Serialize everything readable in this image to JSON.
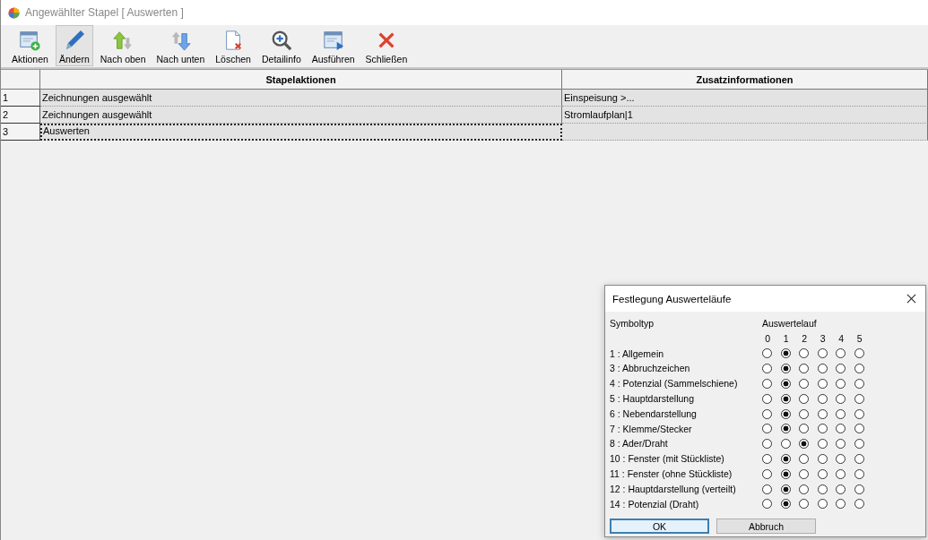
{
  "window": {
    "title": "Angewählter Stapel  [ Auswerten ]"
  },
  "toolbar": [
    {
      "kind": "add",
      "label": "Aktionen",
      "selected": false
    },
    {
      "kind": "edit",
      "label": "Ändern",
      "selected": true
    },
    {
      "kind": "up",
      "label": "Nach oben",
      "selected": false
    },
    {
      "kind": "down",
      "label": "Nach unten",
      "selected": false
    },
    {
      "kind": "delete",
      "label": "Löschen",
      "selected": false
    },
    {
      "kind": "zoom",
      "label": "Detailinfo",
      "selected": false
    },
    {
      "kind": "run",
      "label": "Ausführen",
      "selected": false
    },
    {
      "kind": "close",
      "label": "Schließen",
      "selected": false
    }
  ],
  "table": {
    "columns": [
      "Stapelaktionen",
      "Zusatzinformationen"
    ],
    "rows": [
      {
        "number": "1",
        "cells": [
          "Zeichnungen ausgewählt",
          "Einspeisung >..."
        ],
        "selected": false
      },
      {
        "number": "2",
        "cells": [
          "Zeichnungen ausgewählt",
          "Stromlaufplan|1"
        ],
        "selected": false
      },
      {
        "number": "3",
        "cells": [
          "Auswerten",
          ""
        ],
        "selected": true
      }
    ]
  },
  "dialog": {
    "title": "Festlegung Auswerteläufe",
    "label_heading": "Symboltyp",
    "run_heading": "Auswertelauf",
    "run_numbers": [
      "0",
      "1",
      "2",
      "3",
      "4",
      "5"
    ],
    "rows": [
      {
        "label": "1  : Allgemein",
        "options": [
          {
            "selected": false
          },
          {
            "selected": true
          },
          {
            "selected": false
          },
          {
            "selected": false
          },
          {
            "selected": false
          },
          {
            "selected": false
          }
        ]
      },
      {
        "label": "3  : Abbruchzeichen",
        "options": [
          {
            "selected": false
          },
          {
            "selected": true
          },
          {
            "selected": false
          },
          {
            "selected": false
          },
          {
            "selected": false
          },
          {
            "selected": false
          }
        ]
      },
      {
        "label": "4  : Potenzial (Sammelschiene)",
        "options": [
          {
            "selected": false
          },
          {
            "selected": true
          },
          {
            "selected": false
          },
          {
            "selected": false
          },
          {
            "selected": false
          },
          {
            "selected": false
          }
        ]
      },
      {
        "label": "5  : Hauptdarstellung",
        "options": [
          {
            "selected": false
          },
          {
            "selected": true
          },
          {
            "selected": false
          },
          {
            "selected": false
          },
          {
            "selected": false
          },
          {
            "selected": false
          }
        ]
      },
      {
        "label": "6  : Nebendarstellung",
        "options": [
          {
            "selected": false
          },
          {
            "selected": true
          },
          {
            "selected": false
          },
          {
            "selected": false
          },
          {
            "selected": false
          },
          {
            "selected": false
          }
        ]
      },
      {
        "label": "7  : Klemme/Stecker",
        "options": [
          {
            "selected": false
          },
          {
            "selected": true
          },
          {
            "selected": false
          },
          {
            "selected": false
          },
          {
            "selected": false
          },
          {
            "selected": false
          }
        ]
      },
      {
        "label": "8  : Ader/Draht",
        "options": [
          {
            "selected": false
          },
          {
            "selected": false
          },
          {
            "selected": true
          },
          {
            "selected": false
          },
          {
            "selected": false
          },
          {
            "selected": false
          }
        ]
      },
      {
        "label": "10 : Fenster (mit Stückliste)",
        "options": [
          {
            "selected": false
          },
          {
            "selected": true
          },
          {
            "selected": false
          },
          {
            "selected": false
          },
          {
            "selected": false
          },
          {
            "selected": false
          }
        ]
      },
      {
        "label": "11 : Fenster (ohne Stückliste)",
        "options": [
          {
            "selected": false
          },
          {
            "selected": true
          },
          {
            "selected": false
          },
          {
            "selected": false
          },
          {
            "selected": false
          },
          {
            "selected": false
          }
        ]
      },
      {
        "label": "12 : Hauptdarstellung (verteilt)",
        "options": [
          {
            "selected": false
          },
          {
            "selected": true
          },
          {
            "selected": false
          },
          {
            "selected": false
          },
          {
            "selected": false
          },
          {
            "selected": false
          }
        ]
      },
      {
        "label": "14 : Potenzial (Draht)",
        "options": [
          {
            "selected": false
          },
          {
            "selected": true
          },
          {
            "selected": false
          },
          {
            "selected": false
          },
          {
            "selected": false
          },
          {
            "selected": false
          }
        ]
      }
    ],
    "buttons": [
      {
        "label": "OK",
        "selected": true
      },
      {
        "label": "Abbruch",
        "selected": false
      }
    ]
  }
}
